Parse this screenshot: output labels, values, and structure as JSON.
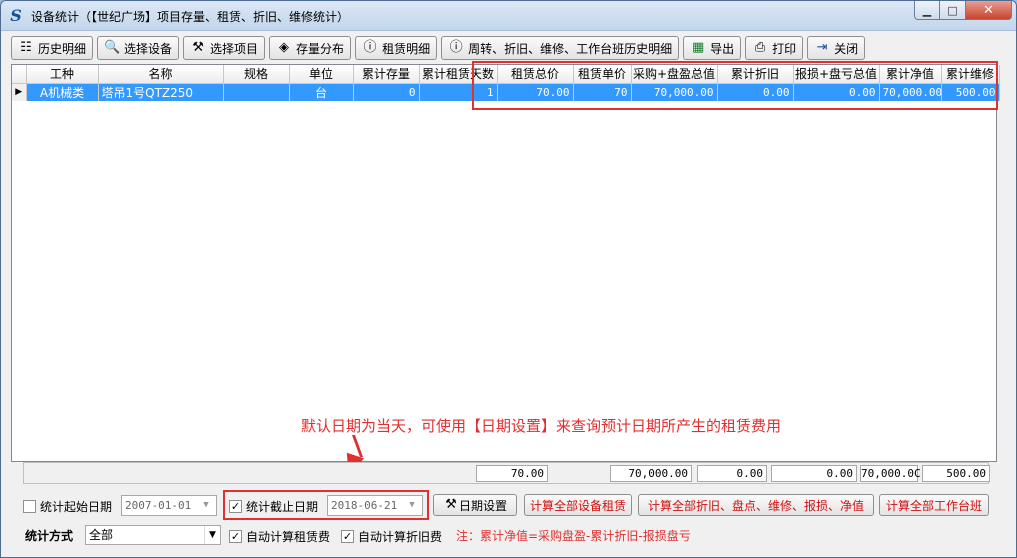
{
  "window": {
    "title": "设备统计（【世纪广场】项目存量、租赁、折旧、维修统计）",
    "app_icon": "S",
    "min_glyph": "▁",
    "max_glyph": "□",
    "close_glyph": "✕"
  },
  "toolbar": [
    {
      "label": "历史明细",
      "icon": "history-icon",
      "glyph": "☷"
    },
    {
      "label": "选择设备",
      "icon": "search-icon",
      "glyph": "🔍"
    },
    {
      "label": "选择项目",
      "icon": "tools-icon",
      "glyph": "⚒"
    },
    {
      "label": "存量分布",
      "icon": "distribution-icon",
      "glyph": "◈"
    },
    {
      "label": "租赁明细",
      "icon": "info-icon",
      "glyph": "ⓘ"
    },
    {
      "label": "周转、折旧、维修、工作台班历史明细",
      "icon": "info-icon",
      "glyph": "ⓘ"
    },
    {
      "label": "导出",
      "icon": "excel-icon",
      "glyph": "▦"
    },
    {
      "label": "打印",
      "icon": "printer-icon",
      "glyph": "⎙"
    },
    {
      "label": "关闭",
      "icon": "exit-icon",
      "glyph": "⇥"
    }
  ],
  "grid": {
    "columns": [
      "工种",
      "名称",
      "规格",
      "单位",
      "累计存量",
      "累计租赁天数",
      "租赁总价",
      "租赁单价",
      "采购+盘盈总值",
      "累计折旧",
      "报损+盘亏总值",
      "累计净值",
      "累计维修"
    ],
    "row_indicator": "▶",
    "rows": [
      [
        "A机械类",
        "塔吊1号QTZ250",
        "",
        "台",
        "0",
        "1",
        "70.00",
        "70",
        "70,000.00",
        "0.00",
        "0.00",
        "70,000.00",
        "500.00"
      ]
    ]
  },
  "totals": {
    "rent_total": "70.00",
    "purchase_total": "70,000.00",
    "depreciation": "0.00",
    "loss_total": "0.00",
    "net_value": "70,000.0C",
    "repair": "500.00"
  },
  "annotation": "默认日期为当天，可使用【日期设置】来查询预计日期所产生的租赁费用",
  "filters": {
    "start_date_label": "统计起始日期",
    "start_date_checked": false,
    "start_date_value": "2007-01-01",
    "end_date_label": "统计截止日期",
    "end_date_checked": true,
    "end_date_value": "2018-06-21",
    "date_settings_label": "日期设置",
    "calc_rent_label": "计算全部设备租赁",
    "calc_depr_label": "计算全部折旧、盘点、维修、报损、净值",
    "calc_shift_label": "计算全部工作台班",
    "stat_mode_label": "统计方式",
    "stat_mode_value": "全部",
    "auto_rent_label": "自动计算租赁费",
    "auto_rent_checked": true,
    "auto_depr_label": "自动计算折旧费",
    "auto_depr_checked": true,
    "note": "注：累计净值=采购盘盈-累计折旧-报损盘亏"
  },
  "colors": {
    "selection": "#3399ff",
    "highlight": "#e03030"
  }
}
